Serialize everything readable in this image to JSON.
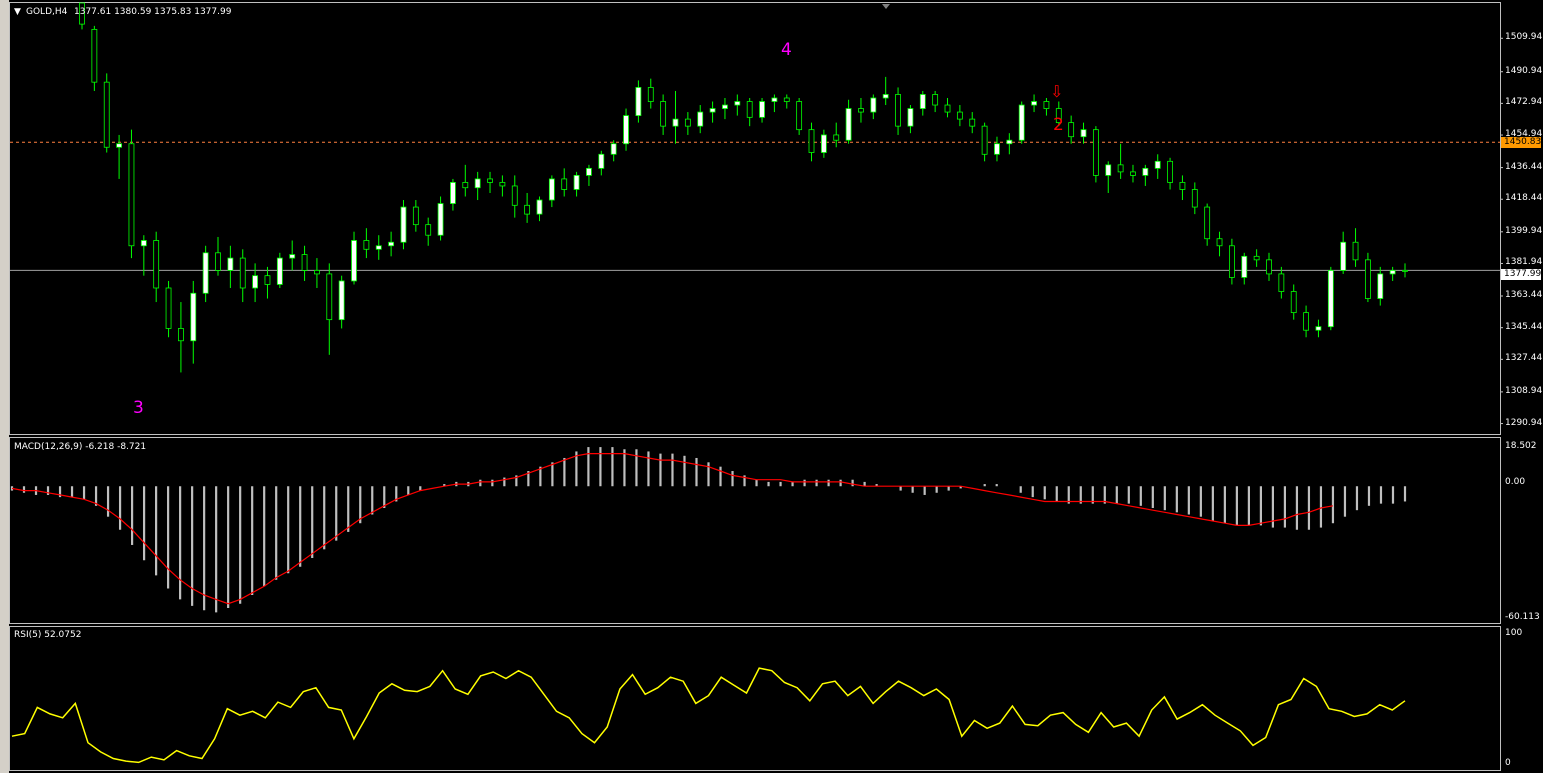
{
  "symbol_header": {
    "dropdown_glyph": "▼",
    "symbol": "GOLD,H4",
    "ohlc": "1377.61 1380.59 1375.83 1377.99"
  },
  "price_axis": {
    "ticks": [
      "1509.94",
      "1490.94",
      "1472.94",
      "1454.94",
      "1436.44",
      "1418.44",
      "1399.94",
      "1381.94",
      "1363.44",
      "1345.44",
      "1327.44",
      "1308.94",
      "1290.94"
    ],
    "tick_values": [
      1509.94,
      1490.94,
      1472.94,
      1454.94,
      1436.44,
      1418.44,
      1399.94,
      1381.94,
      1363.44,
      1345.44,
      1327.44,
      1308.94,
      1290.94
    ],
    "highlight_level": "1450.83",
    "current_price": "1377.99"
  },
  "markers": {
    "wave_3": "3",
    "wave_4": "4",
    "wave_2": "2",
    "sell_arrow": "⇩"
  },
  "macd": {
    "label": "MACD(12,26,9) -6.218 -8.721",
    "axis_top": "18.502",
    "axis_zero": "0.00",
    "axis_bottom": "-60.113"
  },
  "rsi": {
    "label": "RSI(5) 52.0752",
    "axis_top": "100",
    "axis_bottom": "0"
  },
  "colors": {
    "background": "#000000",
    "bull_candle": "#ffffff",
    "bear_candle": "#000000",
    "wick": "#00ff00",
    "macd_hist": "#c0c0c0",
    "macd_signal": "#ff0000",
    "rsi_line": "#ffff00",
    "wave_label_magenta": "#ff00ff",
    "wave_label_red": "#ff0000",
    "level_line": "#ff8040",
    "price_tag_orange": "#ff9900"
  },
  "chart_data": [
    {
      "type": "candlestick",
      "title": "GOLD,H4",
      "ylim": [
        1285,
        1530
      ],
      "horizontal_levels": [
        1450.83,
        1377.99
      ],
      "ohlc": [
        [
          1535,
          1537,
          1515,
          1518
        ],
        [
          1515,
          1517,
          1480,
          1485
        ],
        [
          1485,
          1490,
          1445,
          1448
        ],
        [
          1448,
          1455,
          1430,
          1450
        ],
        [
          1450,
          1458,
          1385,
          1392
        ],
        [
          1392,
          1398,
          1375,
          1395
        ],
        [
          1395,
          1400,
          1360,
          1368
        ],
        [
          1368,
          1372,
          1340,
          1345
        ],
        [
          1345,
          1360,
          1320,
          1338
        ],
        [
          1338,
          1372,
          1325,
          1365
        ],
        [
          1365,
          1392,
          1360,
          1388
        ],
        [
          1388,
          1397,
          1375,
          1378
        ],
        [
          1378,
          1392,
          1368,
          1385
        ],
        [
          1385,
          1390,
          1360,
          1368
        ],
        [
          1368,
          1382,
          1360,
          1375
        ],
        [
          1375,
          1380,
          1362,
          1370
        ],
        [
          1370,
          1388,
          1368,
          1385
        ],
        [
          1385,
          1395,
          1378,
          1387
        ],
        [
          1387,
          1392,
          1372,
          1378
        ],
        [
          1378,
          1385,
          1368,
          1376
        ],
        [
          1376,
          1382,
          1330,
          1350
        ],
        [
          1350,
          1375,
          1345,
          1372
        ],
        [
          1372,
          1400,
          1370,
          1395
        ],
        [
          1395,
          1402,
          1385,
          1390
        ],
        [
          1390,
          1398,
          1384,
          1392
        ],
        [
          1392,
          1400,
          1386,
          1394
        ],
        [
          1394,
          1418,
          1390,
          1414
        ],
        [
          1414,
          1418,
          1400,
          1404
        ],
        [
          1404,
          1408,
          1392,
          1398
        ],
        [
          1398,
          1420,
          1395,
          1416
        ],
        [
          1416,
          1430,
          1412,
          1428
        ],
        [
          1428,
          1438,
          1420,
          1425
        ],
        [
          1425,
          1434,
          1418,
          1430
        ],
        [
          1430,
          1434,
          1422,
          1428
        ],
        [
          1428,
          1432,
          1420,
          1426
        ],
        [
          1426,
          1432,
          1408,
          1415
        ],
        [
          1415,
          1422,
          1405,
          1410
        ],
        [
          1410,
          1420,
          1406,
          1418
        ],
        [
          1418,
          1432,
          1414,
          1430
        ],
        [
          1430,
          1436,
          1420,
          1424
        ],
        [
          1424,
          1434,
          1420,
          1432
        ],
        [
          1432,
          1438,
          1426,
          1436
        ],
        [
          1436,
          1446,
          1432,
          1444
        ],
        [
          1444,
          1452,
          1440,
          1450
        ],
        [
          1450,
          1470,
          1446,
          1466
        ],
        [
          1466,
          1486,
          1462,
          1482
        ],
        [
          1482,
          1487,
          1470,
          1474
        ],
        [
          1474,
          1478,
          1455,
          1460
        ],
        [
          1460,
          1480,
          1450,
          1464
        ],
        [
          1464,
          1468,
          1455,
          1460
        ],
        [
          1460,
          1472,
          1456,
          1468
        ],
        [
          1468,
          1474,
          1462,
          1470
        ],
        [
          1470,
          1476,
          1464,
          1472
        ],
        [
          1472,
          1478,
          1466,
          1474
        ],
        [
          1474,
          1476,
          1460,
          1465
        ],
        [
          1465,
          1476,
          1462,
          1474
        ],
        [
          1474,
          1478,
          1468,
          1476
        ],
        [
          1476,
          1478,
          1470,
          1474
        ],
        [
          1474,
          1476,
          1455,
          1458
        ],
        [
          1458,
          1462,
          1440,
          1445
        ],
        [
          1445,
          1458,
          1442,
          1455
        ],
        [
          1455,
          1462,
          1448,
          1452
        ],
        [
          1452,
          1475,
          1450,
          1470
        ],
        [
          1470,
          1476,
          1462,
          1468
        ],
        [
          1468,
          1478,
          1464,
          1476
        ],
        [
          1476,
          1488,
          1472,
          1478
        ],
        [
          1478,
          1482,
          1455,
          1460
        ],
        [
          1460,
          1472,
          1456,
          1470
        ],
        [
          1470,
          1480,
          1466,
          1478
        ],
        [
          1478,
          1480,
          1468,
          1472
        ],
        [
          1472,
          1476,
          1465,
          1468
        ],
        [
          1468,
          1472,
          1460,
          1464
        ],
        [
          1464,
          1468,
          1456,
          1460
        ],
        [
          1460,
          1462,
          1440,
          1444
        ],
        [
          1444,
          1454,
          1440,
          1450
        ],
        [
          1450,
          1456,
          1444,
          1452
        ],
        [
          1452,
          1474,
          1450,
          1472
        ],
        [
          1472,
          1478,
          1468,
          1474
        ],
        [
          1474,
          1476,
          1466,
          1470
        ],
        [
          1470,
          1474,
          1460,
          1462
        ],
        [
          1462,
          1466,
          1450,
          1454
        ],
        [
          1454,
          1462,
          1450,
          1458
        ],
        [
          1458,
          1460,
          1428,
          1432
        ],
        [
          1432,
          1440,
          1422,
          1438
        ],
        [
          1438,
          1450,
          1430,
          1434
        ],
        [
          1434,
          1438,
          1428,
          1432
        ],
        [
          1432,
          1438,
          1426,
          1436
        ],
        [
          1436,
          1444,
          1430,
          1440
        ],
        [
          1440,
          1442,
          1424,
          1428
        ],
        [
          1428,
          1432,
          1418,
          1424
        ],
        [
          1424,
          1428,
          1410,
          1414
        ],
        [
          1414,
          1416,
          1392,
          1396
        ],
        [
          1396,
          1400,
          1386,
          1392
        ],
        [
          1392,
          1396,
          1370,
          1374
        ],
        [
          1374,
          1388,
          1370,
          1386
        ],
        [
          1386,
          1390,
          1380,
          1384
        ],
        [
          1384,
          1388,
          1372,
          1376
        ],
        [
          1376,
          1380,
          1362,
          1366
        ],
        [
          1366,
          1370,
          1350,
          1354
        ],
        [
          1354,
          1358,
          1340,
          1344
        ],
        [
          1344,
          1350,
          1340,
          1346
        ],
        [
          1346,
          1380,
          1344,
          1378
        ],
        [
          1378,
          1400,
          1376,
          1394
        ],
        [
          1394,
          1402,
          1380,
          1384
        ],
        [
          1384,
          1388,
          1360,
          1362
        ],
        [
          1362,
          1380,
          1358,
          1376
        ],
        [
          1376,
          1380,
          1372,
          1378
        ],
        [
          1378,
          1382,
          1374,
          1377.99
        ]
      ]
    },
    {
      "type": "bar",
      "title": "MACD(12,26,9) -6.218 -8.721",
      "ylim": [
        -60.113,
        18.502
      ],
      "series": [
        {
          "name": "MACD",
          "values": [
            -2,
            -3,
            -4,
            -4,
            -5,
            -5,
            -6,
            -9,
            -14,
            -20,
            -27,
            -34,
            -41,
            -47,
            -52,
            -55,
            -57,
            -58,
            -56,
            -54,
            -50,
            -46,
            -43,
            -40,
            -37,
            -33,
            -29,
            -25,
            -21,
            -17,
            -13,
            -10,
            -7,
            -4,
            -2,
            0,
            1,
            2,
            2,
            3,
            3,
            4,
            5,
            7,
            9,
            11,
            13,
            16,
            18,
            18,
            18,
            17,
            17,
            16,
            15,
            15,
            14,
            13,
            11,
            9,
            7,
            5,
            3,
            2,
            2,
            2,
            3,
            3,
            3,
            3,
            3,
            2,
            1,
            0,
            -2,
            -3,
            -4,
            -3,
            -2,
            -1,
            0,
            1,
            1,
            0,
            -3,
            -5,
            -6,
            -7,
            -8,
            -8,
            -8,
            -8,
            -8,
            -8,
            -9,
            -10,
            -11,
            -12,
            -13,
            -14,
            -16,
            -17,
            -18,
            -18,
            -18,
            -19,
            -19,
            -20,
            -20,
            -19,
            -17,
            -14,
            -11,
            -9,
            -8,
            -8,
            -7
          ]
        },
        {
          "name": "Signal",
          "values": [
            -1,
            -2,
            -2,
            -3,
            -4,
            -5,
            -6,
            -8,
            -11,
            -15,
            -20,
            -26,
            -32,
            -38,
            -43,
            -47,
            -50,
            -52,
            -54,
            -52,
            -49,
            -46,
            -42,
            -39,
            -35,
            -31,
            -27,
            -23,
            -19,
            -15,
            -12,
            -9,
            -6,
            -4,
            -2,
            -1,
            0,
            1,
            1,
            2,
            2,
            3,
            4,
            6,
            8,
            10,
            12,
            14,
            15,
            15,
            15,
            15,
            14,
            13,
            12,
            12,
            11,
            10,
            9,
            7,
            5,
            4,
            3,
            3,
            3,
            2,
            2,
            2,
            2,
            2,
            1,
            0,
            0,
            0,
            0,
            0,
            0,
            0,
            0,
            0,
            -1,
            -2,
            -3,
            -4,
            -5,
            -6,
            -7,
            -7,
            -7,
            -7,
            -7,
            -7,
            -8,
            -9,
            -10,
            -11,
            -12,
            -13,
            -14,
            -15,
            -16,
            -17,
            -18,
            -18,
            -17,
            -16,
            -15,
            -13,
            -12,
            -10,
            -9
          ]
        }
      ]
    },
    {
      "type": "line",
      "title": "RSI(5) 52.0752",
      "ylim": [
        0,
        100
      ],
      "series": [
        {
          "name": "RSI(5)",
          "values": [
            22,
            24,
            44,
            39,
            36,
            47,
            17,
            10,
            5,
            3,
            2,
            6,
            4,
            11,
            7,
            5,
            20,
            43,
            38,
            41,
            36,
            48,
            44,
            56,
            59,
            44,
            42,
            20,
            37,
            55,
            62,
            57,
            56,
            60,
            72,
            58,
            54,
            68,
            71,
            66,
            72,
            67,
            54,
            41,
            36,
            24,
            17,
            29,
            58,
            69,
            54,
            59,
            67,
            64,
            47,
            53,
            67,
            61,
            55,
            74,
            72,
            63,
            59,
            49,
            62,
            64,
            53,
            60,
            47,
            56,
            64,
            59,
            53,
            58,
            50,
            22,
            34,
            28,
            32,
            45,
            31,
            30,
            38,
            40,
            31,
            25,
            40,
            29,
            32,
            22,
            42,
            52,
            35,
            40,
            46,
            38,
            32,
            26,
            15,
            21,
            46,
            50,
            66,
            60,
            43,
            41,
            37,
            39,
            46,
            42,
            49
          ]
        }
      ]
    }
  ]
}
